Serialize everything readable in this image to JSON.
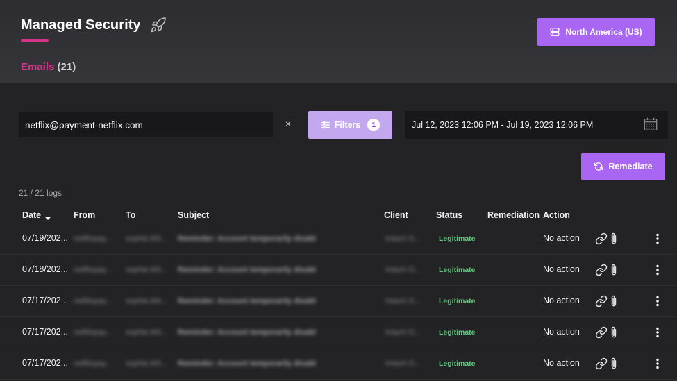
{
  "header": {
    "title": "Managed Security",
    "region_button_label": "North America (US)",
    "section_label": "Emails",
    "section_count": "(21)"
  },
  "toolbar": {
    "search_value": "netflix@payment-netflix.com",
    "clear_glyph": "×",
    "filters_label": "Filters",
    "filters_count": "1",
    "date_range": "Jul 12, 2023 12:06 PM - Jul 19, 2023 12:06 PM",
    "remediate_label": "Remediate"
  },
  "logs_count": "21 / 21 logs",
  "table": {
    "columns": [
      "Date",
      "From",
      "To",
      "Subject",
      "Client",
      "Status",
      "Remediation",
      "Action"
    ],
    "sorted_column": "Date",
    "sort_direction": "descending",
    "rows": [
      {
        "date": "07/19/202...",
        "from": "netflixpay...",
        "to": "sophie.M3...",
        "subject": "Reminder: Account temporarily disabl",
        "client": "Intach O...",
        "status": "Legitimate",
        "remediation": "",
        "action": "No action"
      },
      {
        "date": "07/18/202...",
        "from": "netflixpay...",
        "to": "sophie.M3...",
        "subject": "Reminder: Account temporarily disabl",
        "client": "Intach O...",
        "status": "Legitimate",
        "remediation": "",
        "action": "No action"
      },
      {
        "date": "07/17/202...",
        "from": "netflixpay...",
        "to": "sophie.M3...",
        "subject": "Reminder: Account temporarily disabl",
        "client": "Intach O...",
        "status": "Legitimate",
        "remediation": "",
        "action": "No action"
      },
      {
        "date": "07/17/202...",
        "from": "netflixpay...",
        "to": "sophie.M3...",
        "subject": "Reminder: Account temporarily disabl",
        "client": "Intach O...",
        "status": "Legitimate",
        "remediation": "",
        "action": "No action"
      },
      {
        "date": "07/17/202...",
        "from": "netflixpay...",
        "to": "sophie.M3...",
        "subject": "Reminder: Account temporarily disabl",
        "client": "Intach O...",
        "status": "Legitimate",
        "remediation": "",
        "action": "No action"
      }
    ]
  },
  "icons": {
    "title_icon": "rocket-icon",
    "region_icon": "server-icon",
    "filters_icon": "sliders-icon",
    "date_icon": "calendar-icon",
    "remediate_icon": "refresh-icon",
    "row_icons": [
      "link-icon",
      "paperclip-icon",
      "more-vertical-icon"
    ]
  },
  "colors": {
    "accent_purple": "#a966f2",
    "accent_pink": "#d6338a",
    "status_legitimate": "#5ec97a",
    "background": "#232326"
  }
}
